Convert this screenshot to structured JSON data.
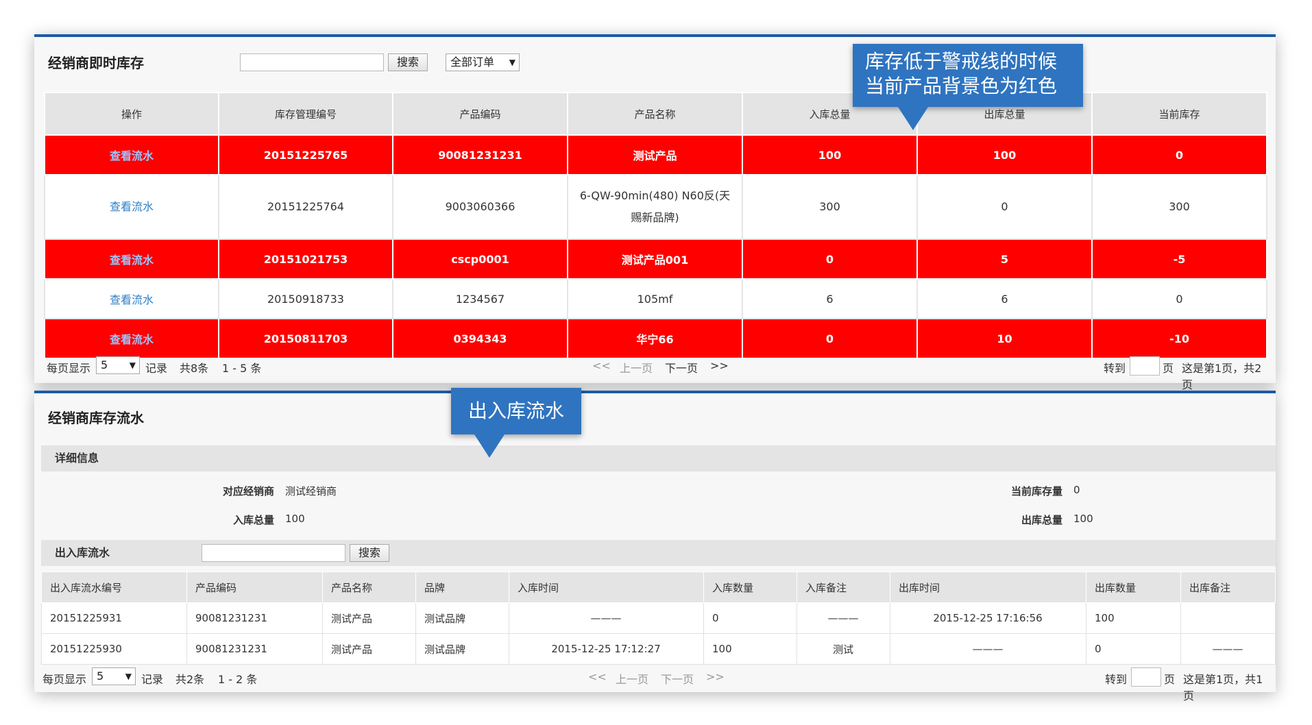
{
  "stock": {
    "title": "经销商即时库存",
    "search_button": "搜索",
    "filter_select": "全部订单",
    "columns": [
      "操作",
      "库存管理编号",
      "产品编码",
      "产品名称",
      "入库总量",
      "出库总量",
      "当前库存"
    ],
    "rows": [
      {
        "action": "查看流水",
        "id": "20151225765",
        "code": "90081231231",
        "name": "测试产品",
        "in": "100",
        "out": "100",
        "current": "0",
        "low": true
      },
      {
        "action": "查看流水",
        "id": "20151225764",
        "code": "9003060366",
        "name": "6-QW-90min(480) N60反(天赐新品牌)",
        "in": "300",
        "out": "0",
        "current": "300",
        "low": false
      },
      {
        "action": "查看流水",
        "id": "20151021753",
        "code": "cscp0001",
        "name": "测试产品001",
        "in": "0",
        "out": "5",
        "current": "-5",
        "low": true
      },
      {
        "action": "查看流水",
        "id": "20150918733",
        "code": "1234567",
        "name": "105mf",
        "in": "6",
        "out": "6",
        "current": "0",
        "low": false
      },
      {
        "action": "查看流水",
        "id": "20150811703",
        "code": "0394343",
        "name": "华宁66",
        "in": "0",
        "out": "10",
        "current": "-10",
        "low": true
      }
    ],
    "pager": {
      "per_page_label": "每页显示",
      "per_page": "5",
      "records_label": "记录",
      "total": "共8条",
      "range": "1 - 5 条",
      "first": "<<",
      "prev": "上一页",
      "next": "下一页",
      "last": ">>",
      "goto_label": "转到",
      "page_unit": "页",
      "page_info": "这是第1页，共2页"
    }
  },
  "callout_stock": {
    "line1": "库存低于警戒线的时候",
    "line2": "当前产品背景色为红色"
  },
  "callout_flow": {
    "text": "出入库流水"
  },
  "flow": {
    "title": "经销商库存流水",
    "detail_bar": "详细信息",
    "dealer_label": "对应经销商",
    "dealer_value": "测试经销商",
    "in_total_label": "入库总量",
    "in_total_value": "100",
    "current_label": "当前库存量",
    "current_value": "0",
    "out_total_label": "出库总量",
    "out_total_value": "100",
    "records_bar": "出入库流水",
    "search_button": "搜索",
    "columns": [
      "出入库流水编号",
      "产品编码",
      "产品名称",
      "品牌",
      "入库时间",
      "入库数量",
      "入库备注",
      "出库时间",
      "出库数量",
      "出库备注"
    ],
    "rows": [
      {
        "id": "20151225931",
        "code": "90081231231",
        "name": "测试产品",
        "brand": "测试品牌",
        "in_time": "———",
        "in_qty": "0",
        "in_note": "———",
        "out_time": "2015-12-25 17:16:56",
        "out_qty": "100",
        "out_note": ""
      },
      {
        "id": "20151225930",
        "code": "90081231231",
        "name": "测试产品",
        "brand": "测试品牌",
        "in_time": "2015-12-25 17:12:27",
        "in_qty": "100",
        "in_note": "测试",
        "out_time": "———",
        "out_qty": "0",
        "out_note": "———"
      }
    ],
    "pager": {
      "per_page_label": "每页显示",
      "per_page": "5",
      "records_label": "记录",
      "total": "共2条",
      "range": "1 - 2 条",
      "first": "<<",
      "prev": "上一页",
      "next": "下一页",
      "last": ">>",
      "goto_label": "转到",
      "page_unit": "页",
      "page_info": "这是第1页，共1页"
    }
  },
  "colors": {
    "accent": "#1d5aa5",
    "alert_row": "#ff0000",
    "callout": "#2f74c0",
    "link": "#2f7fc8",
    "positive": "#2e8b2e"
  }
}
